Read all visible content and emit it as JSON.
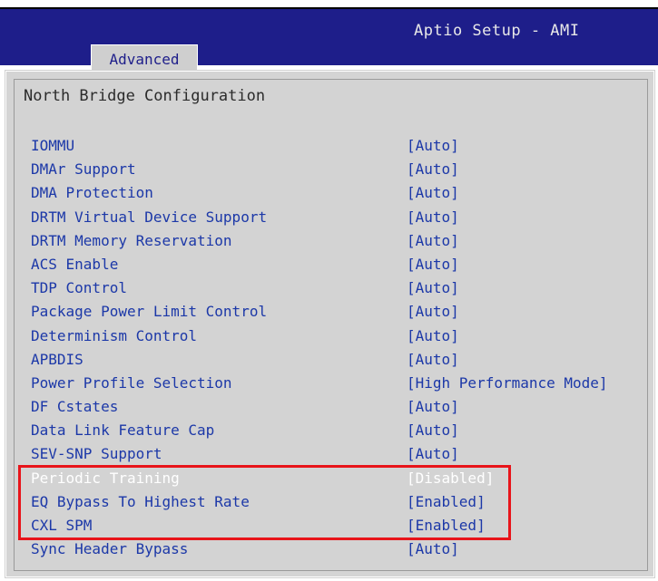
{
  "header": {
    "title": "Aptio Setup - AMI",
    "tabs": [
      {
        "label": "Advanced",
        "active": true
      }
    ]
  },
  "main": {
    "section_title": "North Bridge Configuration",
    "settings": [
      {
        "label": "IOMMU",
        "value": "[Auto]"
      },
      {
        "label": "DMAr Support",
        "value": "[Auto]"
      },
      {
        "label": "DMA Protection",
        "value": "[Auto]"
      },
      {
        "label": "DRTM Virtual Device Support",
        "value": "[Auto]"
      },
      {
        "label": "DRTM Memory Reservation",
        "value": "[Auto]"
      },
      {
        "label": "ACS Enable",
        "value": "[Auto]"
      },
      {
        "label": "TDP Control",
        "value": "[Auto]"
      },
      {
        "label": "Package Power Limit Control",
        "value": "[Auto]"
      },
      {
        "label": "Determinism Control",
        "value": "[Auto]"
      },
      {
        "label": "APBDIS",
        "value": "[Auto]"
      },
      {
        "label": "Power Profile Selection",
        "value": "[High Performance Mode]"
      },
      {
        "label": "DF Cstates",
        "value": "[Auto]"
      },
      {
        "label": "Data Link Feature Cap",
        "value": "[Auto]"
      },
      {
        "label": "SEV-SNP Support",
        "value": "[Auto]"
      },
      {
        "label": "Periodic Training",
        "value": "[Disabled]",
        "selected": true
      },
      {
        "label": "EQ Bypass To Highest Rate",
        "value": "[Enabled]"
      },
      {
        "label": "CXL SPM",
        "value": "[Enabled]"
      },
      {
        "label": "Sync Header Bypass",
        "value": "[Auto]"
      }
    ]
  },
  "colors": {
    "header_bg": "#1e1e8a",
    "panel_bg": "#d3d3d3",
    "item_text": "#1c38a8",
    "selected_text": "#ffffff",
    "annotation_box": "#e8141a"
  }
}
